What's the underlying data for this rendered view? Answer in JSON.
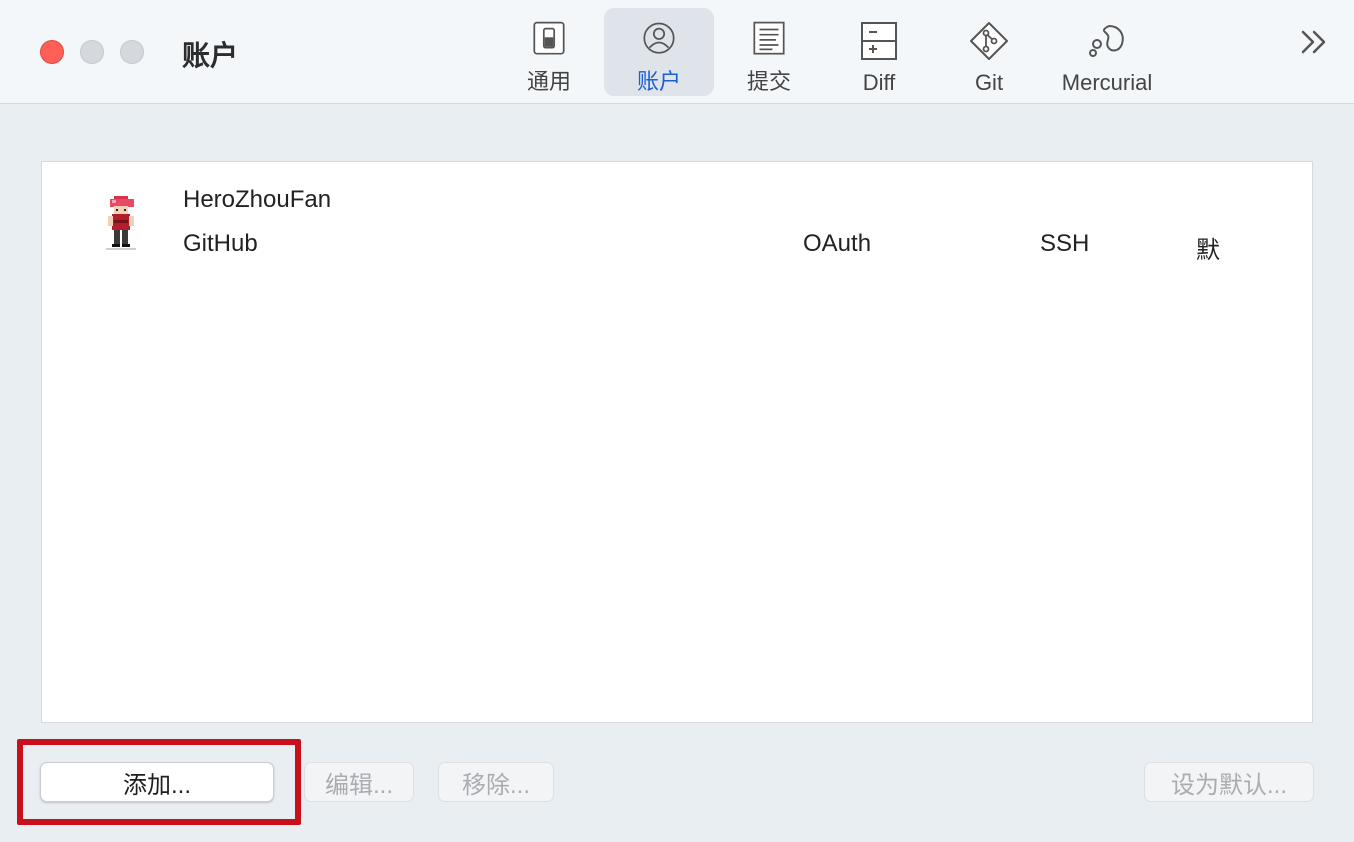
{
  "window": {
    "title": "账户"
  },
  "toolbar": {
    "tabs": [
      {
        "label": "通用",
        "icon": "general-switch-icon",
        "active": false
      },
      {
        "label": "账户",
        "icon": "account-person-icon",
        "active": true
      },
      {
        "label": "提交",
        "icon": "commit-document-icon",
        "active": false
      },
      {
        "label": "Diff",
        "icon": "diff-icon",
        "active": false
      },
      {
        "label": "Git",
        "icon": "git-diamond-icon",
        "active": false
      },
      {
        "label": "Mercurial",
        "icon": "mercurial-icon",
        "active": false
      }
    ],
    "more_icon": "chevron-double-right-icon",
    "accent": "#1a5fd4"
  },
  "accounts": [
    {
      "name": "HeroZhouFan",
      "host": "GitHub",
      "auth": "OAuth",
      "protocol": "SSH",
      "default": "默"
    }
  ],
  "buttons": {
    "add": "添加...",
    "edit": "编辑...",
    "remove": "移除...",
    "set_default": "设为默认..."
  },
  "highlight_color": "#c8101c"
}
